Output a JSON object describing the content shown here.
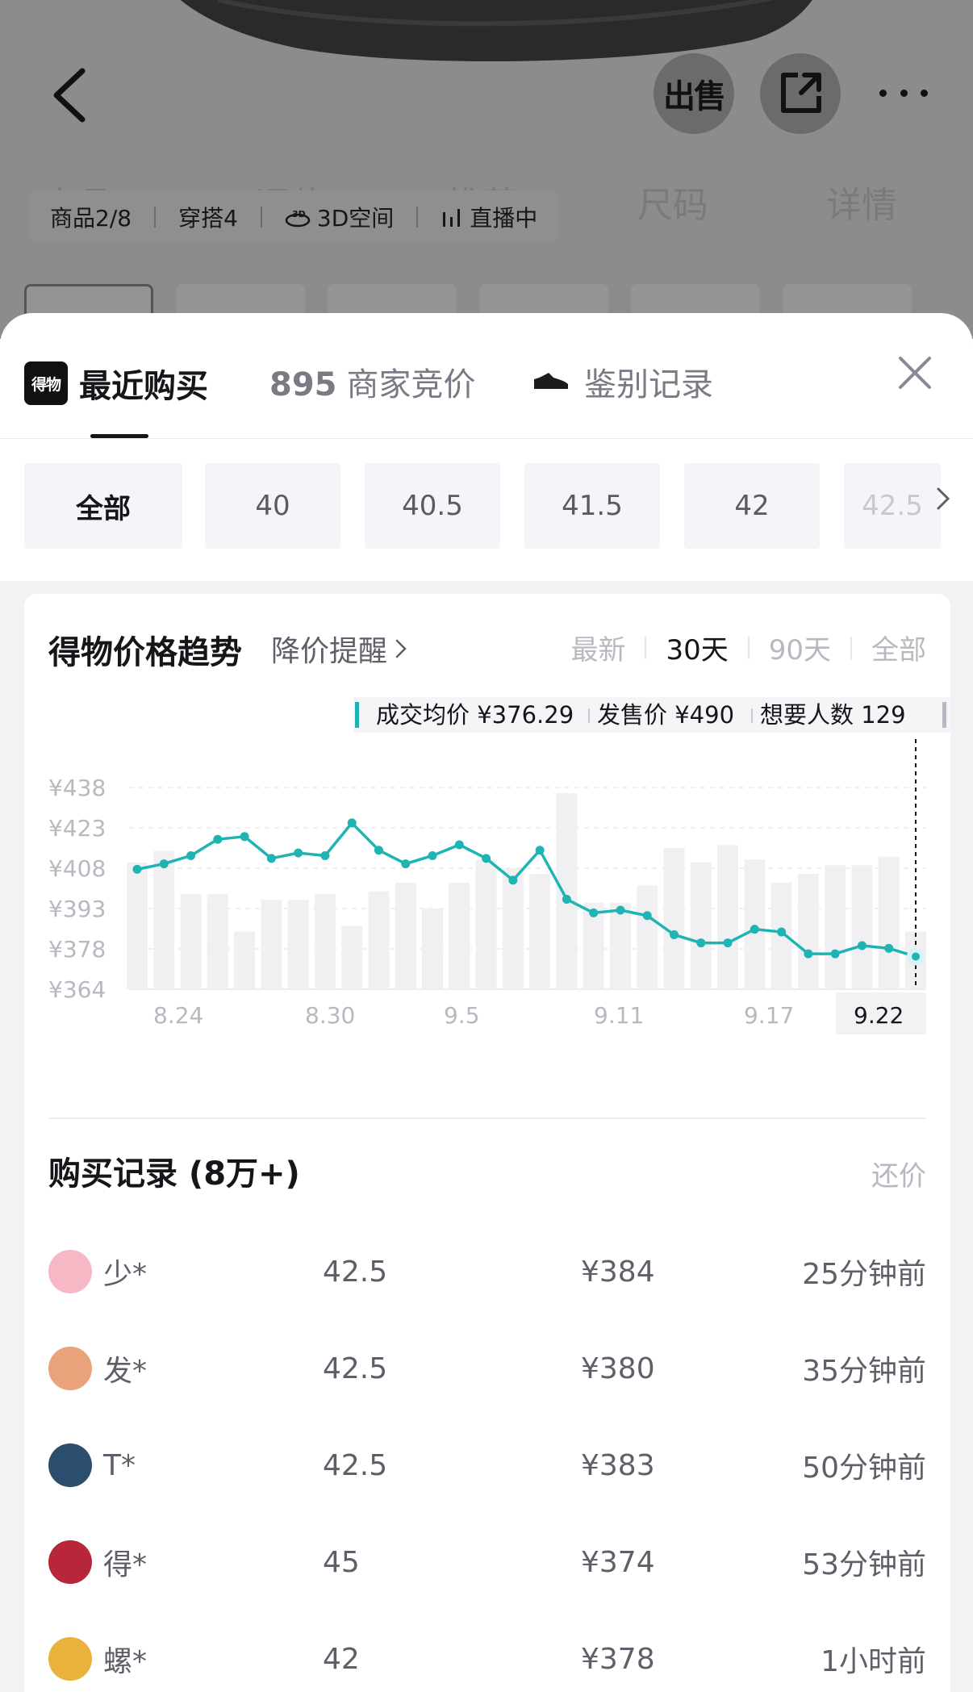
{
  "background_page": {
    "sell_label": "出售",
    "ghost_tabs": [
      "商品",
      "评价",
      "推荐",
      "尺码",
      "详情"
    ],
    "info_pills": [
      {
        "label": "商品2/8"
      },
      {
        "label": "穿搭4"
      },
      {
        "label": "3D空间"
      },
      {
        "label": "直播中"
      }
    ]
  },
  "sheet": {
    "logo_text": "得物",
    "tabs": {
      "recent": "最近购买",
      "bid_count": "895",
      "bid_label": "商家竞价",
      "auth_label": "鉴别记录"
    },
    "sizes": [
      "全部",
      "40",
      "40.5",
      "41.5",
      "42",
      "42.5"
    ],
    "active_size": "全部"
  },
  "trend": {
    "title": "得物价格趋势",
    "alert_label": "降价提醒",
    "ranges": [
      "最新",
      "30天",
      "90天",
      "全部"
    ],
    "active_range": "30天",
    "info_avg_label": "成交均价 ¥376.29",
    "info_release_label": "发售价 ¥490",
    "info_want_label": "想要人数 129"
  },
  "chart_data": {
    "type": "line",
    "x_ticks": [
      "8.24",
      "8.30",
      "9.5",
      "9.11",
      "9.17",
      "9.22"
    ],
    "y_ticks": [
      "¥438",
      "¥423",
      "¥408",
      "¥393",
      "¥378",
      "¥364"
    ],
    "ylim": [
      364,
      438
    ],
    "highlight_x": "9.22",
    "price_series": [
      408,
      410,
      413,
      419,
      420,
      412,
      414,
      413,
      425,
      415,
      410,
      413,
      417,
      412,
      404,
      415,
      397,
      392,
      393,
      391,
      384,
      381,
      381,
      386,
      385,
      377,
      377,
      380,
      379,
      376
    ],
    "volume_bars": [
      44,
      48,
      33,
      33,
      20,
      31,
      31,
      33,
      22,
      34,
      37,
      28,
      37,
      45,
      42,
      40,
      68,
      30,
      30,
      36,
      49,
      44,
      50,
      45,
      37,
      40,
      43,
      43,
      46,
      20
    ],
    "point_color": "#1fb4b4",
    "bar_color": "#f0f0f3"
  },
  "records": {
    "title": "购买记录 (8万+)",
    "offer_label": "还价",
    "rows": [
      {
        "buyer": "少*",
        "size": "42.5",
        "price": "¥384",
        "time": "25分钟前",
        "avatar_color": "#f7b8c6"
      },
      {
        "buyer": "发*",
        "size": "42.5",
        "price": "¥380",
        "time": "35分钟前",
        "avatar_color": "#e9a27a"
      },
      {
        "buyer": "T*",
        "size": "42.5",
        "price": "¥383",
        "time": "50分钟前",
        "avatar_color": "#2b4d6e"
      },
      {
        "buyer": "得*",
        "size": "45",
        "price": "¥374",
        "time": "53分钟前",
        "avatar_color": "#b8263a"
      },
      {
        "buyer": "螺*",
        "size": "42",
        "price": "¥378",
        "time": "1小时前",
        "avatar_color": "#e8b23c"
      }
    ]
  }
}
